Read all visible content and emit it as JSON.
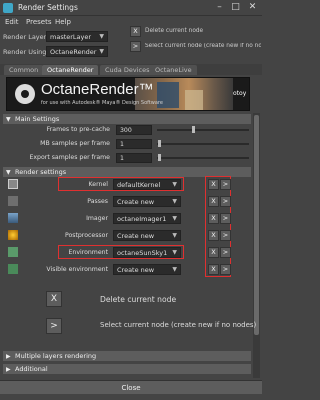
{
  "window": {
    "title": "Render Settings"
  },
  "menu": {
    "items": [
      "Edit",
      "Presets",
      "Help"
    ]
  },
  "render_layer": {
    "label": "Render Layer",
    "value": "masterLayer"
  },
  "render_using": {
    "label": "Render Using",
    "value": "OctaneRender"
  },
  "header_notes": {
    "delete_btn": "X",
    "delete_note": "Delete current node",
    "select_btn": ">",
    "select_note": "Select current node (create new if no nodes)"
  },
  "tabs": [
    {
      "label": "Common"
    },
    {
      "label": "OctaneRender"
    },
    {
      "label": "Cuda Devices"
    },
    {
      "label": "OctaneLive"
    }
  ],
  "banner": {
    "brand": "OctaneRender™",
    "tagline": "for use with Autodesk® Maya® Design Software",
    "partner": "otoy"
  },
  "main_settings": {
    "title": "Main Settings",
    "rows": [
      {
        "label": "Frames to pre-cache",
        "value": "300"
      },
      {
        "label": "MB samples per frame",
        "value": "1"
      },
      {
        "label": "Export samples per frame",
        "value": "1"
      }
    ]
  },
  "render_settings": {
    "title": "Render settings",
    "rows": [
      {
        "label": "Kernel",
        "value": "defaultKernel"
      },
      {
        "label": "Passes",
        "value": "Create new"
      },
      {
        "label": "Imager",
        "value": "octaneImager1"
      },
      {
        "label": "Postprocessor",
        "value": "Create new"
      },
      {
        "label": "Environment",
        "value": "octaneSunSky1"
      },
      {
        "label": "Visible environment",
        "value": "Create new"
      }
    ],
    "btn_x": "X",
    "btn_select": ">"
  },
  "legend": {
    "delete_btn": "X",
    "delete_note": "Delete current node",
    "select_btn": ">",
    "select_note": "Select current node (create new if no nodes)"
  },
  "collapsed_sections": [
    {
      "title": "Multiple layers rendering"
    },
    {
      "title": "Additional"
    }
  ],
  "footer": {
    "close_label": "Close"
  },
  "colors": {
    "highlight": "#e03030",
    "panel": "#444444",
    "frame_header": "#5d5d5d"
  }
}
